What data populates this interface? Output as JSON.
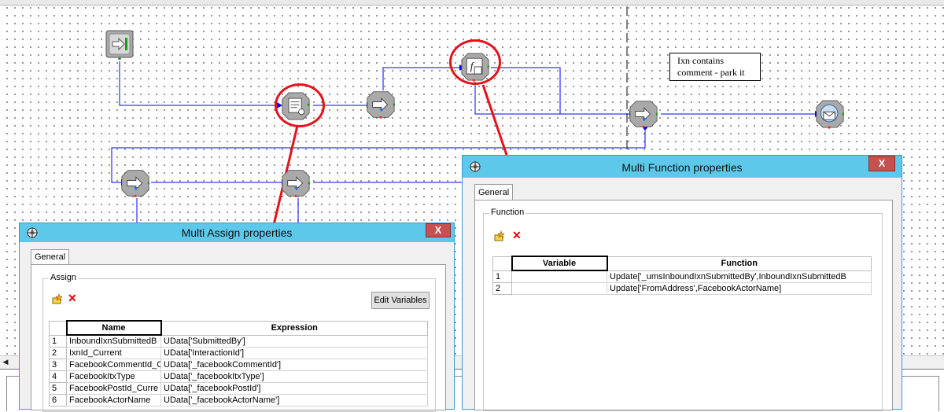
{
  "canvas": {
    "note_line1": "Ixn contains",
    "note_line2": "comment - park it",
    "wire_color": "#0000ff",
    "annotation_color": "#e3131b"
  },
  "nodes": [
    {
      "name": "start-node",
      "icon": "start-icon"
    },
    {
      "name": "multi-assign-node",
      "icon": "multi-assign-icon"
    },
    {
      "name": "decision-node-1",
      "icon": "decision-icon"
    },
    {
      "name": "multi-function-node",
      "icon": "multi-function-icon"
    },
    {
      "name": "decision-node-2",
      "icon": "decision-icon"
    },
    {
      "name": "email-node",
      "icon": "email-icon"
    },
    {
      "name": "decision-node-3",
      "icon": "decision-icon"
    },
    {
      "name": "decision-node-4",
      "icon": "decision-icon"
    }
  ],
  "multi_assign": {
    "title": "Multi Assign properties",
    "close": "X",
    "tab": "General",
    "group": "Assign",
    "edit_variables": "Edit Variables",
    "columns": [
      "Name",
      "Expression"
    ],
    "rows": [
      {
        "n": "1",
        "name": "InboundIxnSubmittedB",
        "expr": "UData['SubmittedBy']"
      },
      {
        "n": "2",
        "name": "IxnId_Current",
        "expr": "UData['InteractionId']"
      },
      {
        "n": "3",
        "name": "FacebookCommentId_C",
        "expr": "UData['_facebookCommentId']"
      },
      {
        "n": "4",
        "name": "FacebookItxType",
        "expr": "UData['_facebookItxType']"
      },
      {
        "n": "5",
        "name": "FacebookPostId_Curre",
        "expr": "UData['_facebookPostId']"
      },
      {
        "n": "6",
        "name": "FacebookActorName",
        "expr": "UData['_facebookActorName']"
      }
    ]
  },
  "multi_function": {
    "title": "Multi Function properties",
    "close": "X",
    "tab": "General",
    "group": "Function",
    "columns": [
      "Variable",
      "Function"
    ],
    "rows": [
      {
        "n": "1",
        "var": "",
        "func": "Update['_umsInboundIxnSubmittedBy',InboundIxnSubmittedB"
      },
      {
        "n": "2",
        "var": "",
        "func": "Update['FromAddress',FacebookActorName]"
      }
    ]
  }
}
